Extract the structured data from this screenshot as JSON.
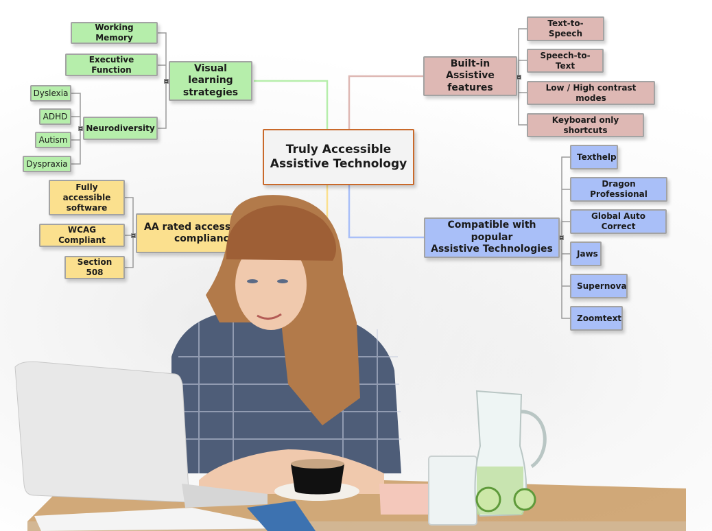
{
  "mindmap": {
    "center": {
      "title_line1": "Truly Accessible",
      "title_line2": "Assistive Technology",
      "border_color": "#c9692a"
    },
    "branches": {
      "visual": {
        "label_line1": "Visual learning",
        "label_line2": "strategies",
        "color": "#b6eeab",
        "children": {
          "working_memory": "Working Memory",
          "executive_function": "Executive Function",
          "neurodiversity": {
            "label": "Neurodiversity",
            "children": [
              "Dyslexia",
              "ADHD",
              "Autism",
              "Dyspraxia"
            ]
          }
        }
      },
      "compliance": {
        "label_line1": "AA rated accessibility",
        "label_line2": "compliance",
        "color": "#fbe08e",
        "children": [
          {
            "line1": "Fully accessible",
            "line2": "software"
          },
          {
            "line1": "WCAG Compliant",
            "line2": ""
          },
          {
            "line1": "Section 508",
            "line2": ""
          }
        ]
      },
      "builtin": {
        "label_line1": "Built-in Assistive",
        "label_line2": "features",
        "color": "#deb8b4",
        "children": [
          "Text-to-Speech",
          "Speech-to-Text",
          "Low / High contrast modes",
          "Keyboard only shortcuts"
        ]
      },
      "compatible": {
        "label_line1": "Compatible with popular",
        "label_line2": "Assistive Technologies",
        "color": "#a9bff8",
        "children": [
          "Texthelp",
          "Dragon Professional",
          "Global Auto Correct",
          "Jaws",
          "Supernova",
          "Zoomtext"
        ]
      }
    }
  },
  "photo": {
    "subject": "woman-using-laptop-at-cafe-table"
  }
}
